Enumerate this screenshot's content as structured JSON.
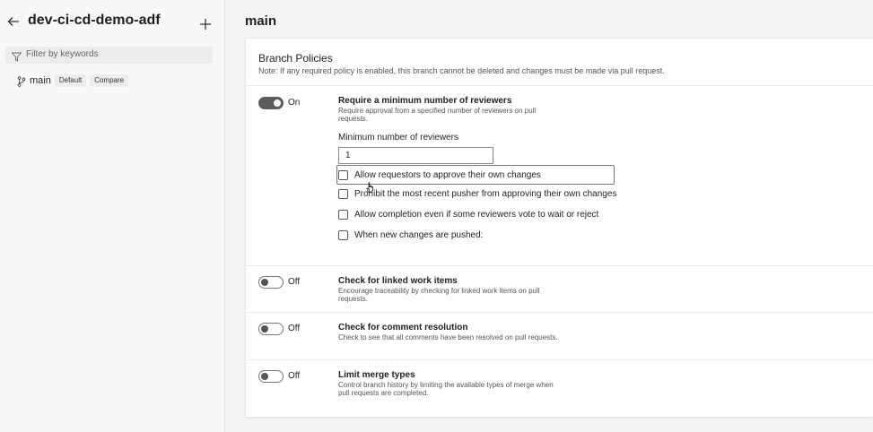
{
  "sidebar": {
    "repo_title": "dev-ci-cd-demo-adf",
    "filter_placeholder": "Filter by keywords",
    "branch": {
      "name": "main",
      "default_badge": "Default",
      "compare_badge": "Compare"
    }
  },
  "main": {
    "title": "main",
    "card": {
      "title": "Branch Policies",
      "note": "Note: If any required policy is enabled, this branch cannot be deleted and changes must be made via pull request."
    },
    "policies": [
      {
        "toggle_state": "On",
        "title": "Require a minimum number of reviewers",
        "description": "Require approval from a specified number of reviewers on pull requests.",
        "field_label": "Minimum number of reviewers",
        "field_value": "1",
        "options": [
          "Allow requestors to approve their own changes",
          "Prohibit the most recent pusher from approving their own changes",
          "Allow completion even if some reviewers vote to wait or reject",
          "When new changes are pushed:"
        ]
      },
      {
        "toggle_state": "Off",
        "title": "Check for linked work items",
        "description": "Encourage traceability by checking for linked work items on pull requests."
      },
      {
        "toggle_state": "Off",
        "title": "Check for comment resolution",
        "description": "Check to see that all comments have been resolved on pull requests."
      },
      {
        "toggle_state": "Off",
        "title": "Limit merge types",
        "description": "Control branch history by limiting the available types of merge when pull requests are completed."
      }
    ]
  },
  "icons": {
    "back": "arrow-left-icon",
    "add": "plus-icon",
    "filter": "filter-icon",
    "branch": "branch-icon",
    "cursor": "hand-cursor-icon"
  }
}
